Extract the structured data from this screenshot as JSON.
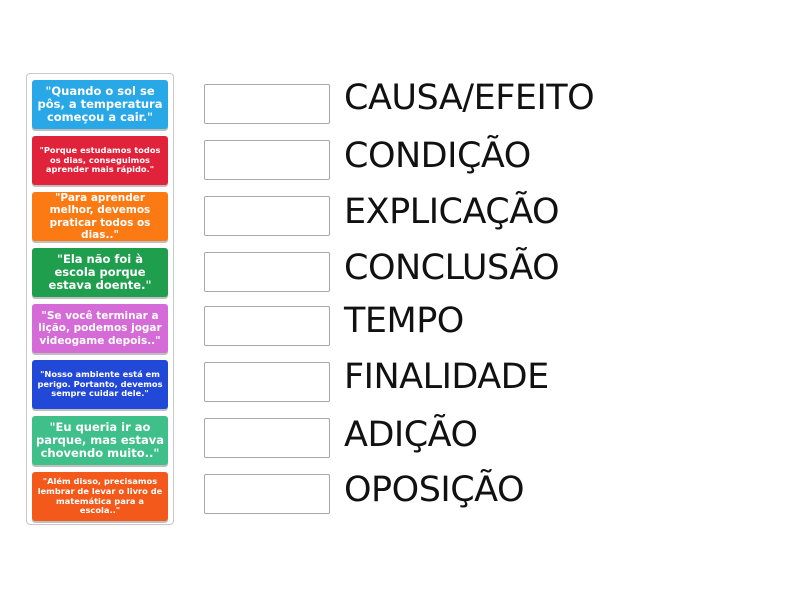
{
  "cards": [
    {
      "text": "\"Quando o sol se pôs, a temperatura começou a cair.\"",
      "color": "#29a8e8"
    },
    {
      "text": "\"Porque estudamos todos os dias, conseguimos aprender mais rápido.\"",
      "color": "#e0223a"
    },
    {
      "text": "\"Para aprender melhor, devemos praticar todos os dias..\"",
      "color": "#fb7a14"
    },
    {
      "text": "\"Ela não foi à escola porque estava doente.\"",
      "color": "#1f9e4e"
    },
    {
      "text": "\"Se você terminar a lição, podemos jogar videogame depois..\"",
      "color": "#d46bd6"
    },
    {
      "text": "\"Nosso ambiente está em perigo. Portanto, devemos sempre cuidar dele.\"",
      "color": "#2248d8"
    },
    {
      "text": "\"Eu queria ir ao parque, mas estava chovendo muito..\"",
      "color": "#3fc08a"
    },
    {
      "text": "\"Além disso, precisamos lembrar de levar o livro de matemática para a escola..\"",
      "color": "#f2591a"
    }
  ],
  "targets": [
    {
      "label": "CAUSA/EFEITO"
    },
    {
      "label": "CONDIÇÃO"
    },
    {
      "label": "EXPLICAÇÃO"
    },
    {
      "label": "CONCLUSÃO"
    },
    {
      "label": "TEMPO"
    },
    {
      "label": "FINALIDADE"
    },
    {
      "label": "ADIÇÃO"
    },
    {
      "label": "OPOSIÇÃO"
    }
  ]
}
